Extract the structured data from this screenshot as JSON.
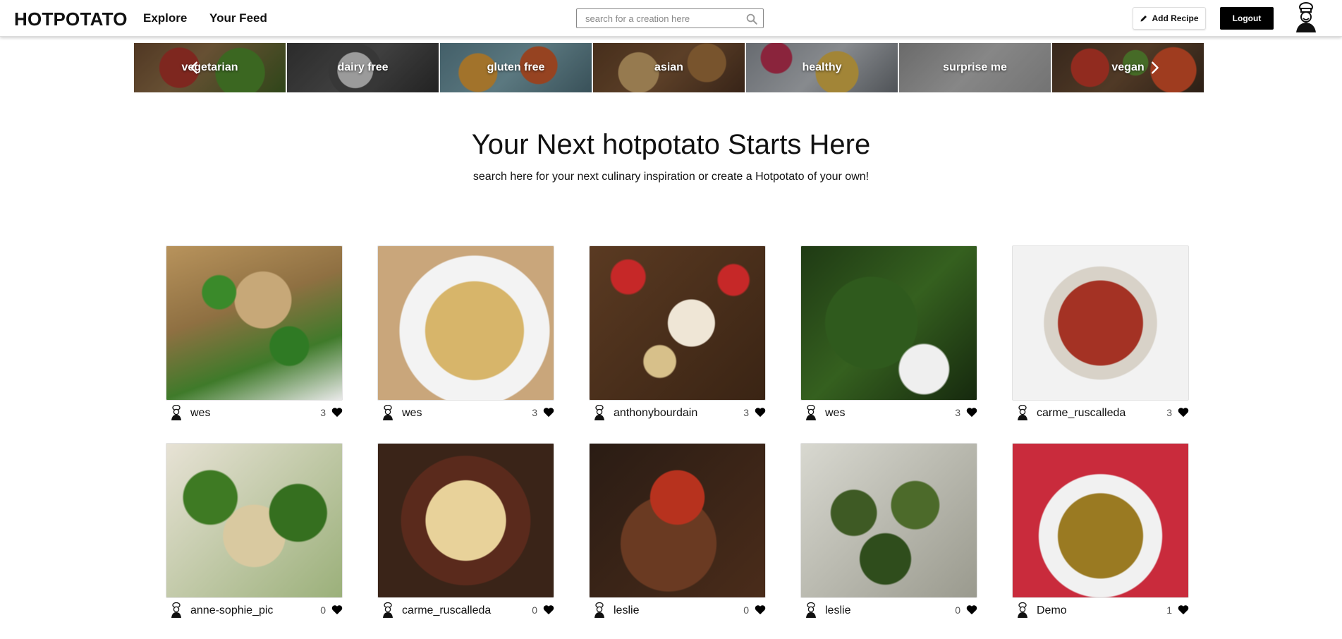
{
  "navbar": {
    "brand": "HOTPOTATO",
    "links": {
      "explore": "Explore",
      "feed": "Your Feed"
    },
    "search": {
      "placeholder": "search for a creation here",
      "value": ""
    },
    "add_recipe_label": "Add Recipe",
    "logout_label": "Logout"
  },
  "categories": [
    "vegetarian",
    "dairy free",
    "gluten free",
    "asian",
    "healthy",
    "surprise me",
    "vegan"
  ],
  "hero": {
    "title": "Your Next hotpotato Starts Here",
    "subtitle": "search here for your next culinary inspiration or create a Hotpotato of your own!"
  },
  "recipes": [
    {
      "author": "wes",
      "likes": "3"
    },
    {
      "author": "wes",
      "likes": "3"
    },
    {
      "author": "anthonybourdain",
      "likes": "3"
    },
    {
      "author": "wes",
      "likes": "3"
    },
    {
      "author": "carme_ruscalleda",
      "likes": "3"
    },
    {
      "author": "anne-sophie_pic",
      "likes": "0"
    },
    {
      "author": "carme_ruscalleda",
      "likes": "0"
    },
    {
      "author": "leslie",
      "likes": "0"
    },
    {
      "author": "leslie",
      "likes": "0"
    },
    {
      "author": "Demo",
      "likes": "1"
    }
  ],
  "icons": {
    "search": "search-icon",
    "pencil": "pencil-icon",
    "chef_avatar": "chef-avatar-icon",
    "heart": "heart-icon",
    "carousel_prev": "chevron-left-icon",
    "carousel_next": "chevron-right-icon"
  },
  "colors": {
    "primary": "#000000",
    "background": "#ffffff",
    "text": "#111111"
  }
}
